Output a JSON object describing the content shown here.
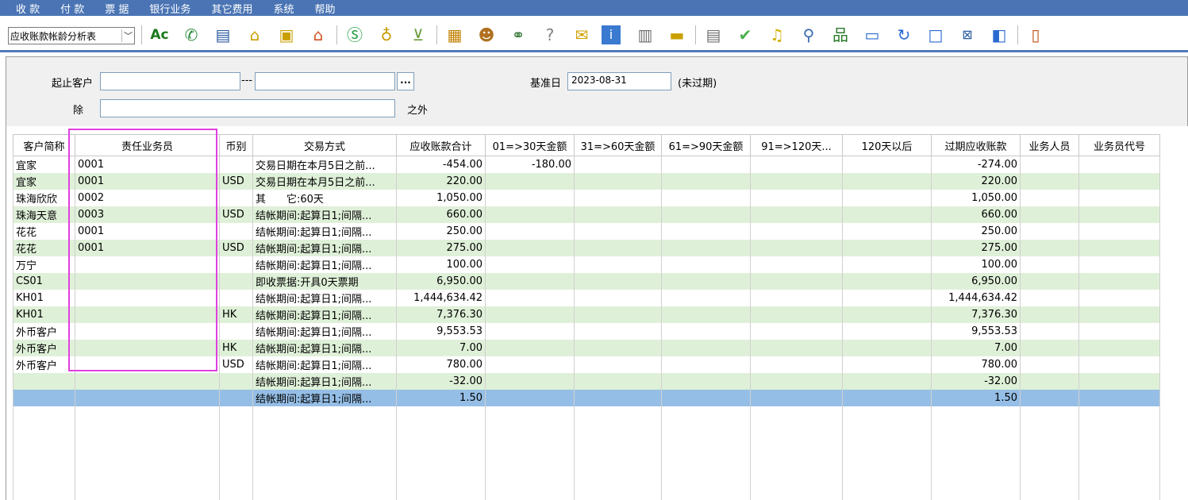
{
  "menu": [
    "收 款",
    "付 款",
    "票 据",
    "银行业务",
    "其它费用",
    "系统",
    "帮助"
  ],
  "toolbar": {
    "module_select": "应收账款帐龄分析表",
    "icons": [
      "spell-check-icon",
      "phone-icon",
      "computer-icon",
      "lock-icon",
      "briefcase-icon",
      "home-icon",
      "dollar-icon",
      "money-bag-icon",
      "cart-icon",
      "clipboard-icon",
      "users-icon",
      "link-icon",
      "help-icon",
      "mail-icon",
      "info-icon",
      "calculator-icon",
      "folder-icon",
      "document-icon",
      "check-icon",
      "bell-icon",
      "search-icon",
      "network-icon",
      "monitor-icon",
      "refresh-icon",
      "window-icon",
      "close-icon",
      "restore-icon",
      "exit-icon"
    ]
  },
  "filter": {
    "customer_range_label": "起止客户",
    "customer_from": "",
    "customer_to": "",
    "range_sep": "---",
    "browse": "...",
    "base_date_label": "基准日",
    "base_date": "2023-08-31",
    "base_date_status": "(未过期)",
    "exclude_label": "除",
    "exclude_value": "",
    "exclude_suffix": "之外"
  },
  "grid": {
    "columns": [
      "客户简称",
      "责任业务员",
      "币别",
      "交易方式",
      "应收账款合计",
      "01=>30天金额",
      "31=>60天金额",
      "61=>90天金额",
      "91=>120天...",
      "120天以后",
      "过期应收账款",
      "业务人员",
      "业务员代号"
    ],
    "rows": [
      [
        "宜家",
        "0001",
        "",
        "交易日期在本月5日之前...",
        "-454.00",
        "-180.00",
        "",
        "",
        "",
        "",
        "-274.00",
        "",
        ""
      ],
      [
        "宜家",
        "0001",
        "USD",
        "交易日期在本月5日之前...",
        "220.00",
        "",
        "",
        "",
        "",
        "",
        "220.00",
        "",
        ""
      ],
      [
        "珠海欣欣",
        "0002",
        "",
        "其　　它:60天",
        "1,050.00",
        "",
        "",
        "",
        "",
        "",
        "1,050.00",
        "",
        ""
      ],
      [
        "珠海天意",
        "0003",
        "USD",
        "结帐期间:起算日1;间隔...",
        "660.00",
        "",
        "",
        "",
        "",
        "",
        "660.00",
        "",
        ""
      ],
      [
        "花花",
        "0001",
        "",
        "结帐期间:起算日1;间隔...",
        "250.00",
        "",
        "",
        "",
        "",
        "",
        "250.00",
        "",
        ""
      ],
      [
        "花花",
        "0001",
        "USD",
        "结帐期间:起算日1;间隔...",
        "275.00",
        "",
        "",
        "",
        "",
        "",
        "275.00",
        "",
        ""
      ],
      [
        "万宁",
        "",
        "",
        "结帐期间:起算日1;间隔...",
        "100.00",
        "",
        "",
        "",
        "",
        "",
        "100.00",
        "",
        ""
      ],
      [
        "CS01",
        "",
        "",
        "即收票据:开具0天票期",
        "6,950.00",
        "",
        "",
        "",
        "",
        "",
        "6,950.00",
        "",
        ""
      ],
      [
        "KH01",
        "",
        "",
        "结帐期间:起算日1;间隔...",
        "1,444,634.42",
        "",
        "",
        "",
        "",
        "",
        "1,444,634.42",
        "",
        ""
      ],
      [
        "KH01",
        "",
        "HK",
        "结帐期间:起算日1;间隔...",
        "7,376.30",
        "",
        "",
        "",
        "",
        "",
        "7,376.30",
        "",
        ""
      ],
      [
        "外币客户",
        "",
        "",
        "结帐期间:起算日1;间隔...",
        "9,553.53",
        "",
        "",
        "",
        "",
        "",
        "9,553.53",
        "",
        ""
      ],
      [
        "外币客户",
        "",
        "HK",
        "结帐期间:起算日1;间隔...",
        "7.00",
        "",
        "",
        "",
        "",
        "",
        "7.00",
        "",
        ""
      ],
      [
        "外币客户",
        "",
        "USD",
        "结帐期间:起算日1;间隔...",
        "780.00",
        "",
        "",
        "",
        "",
        "",
        "780.00",
        "",
        ""
      ],
      [
        "",
        "",
        "",
        "结帐期间:起算日1;间隔...",
        "-32.00",
        "",
        "",
        "",
        "",
        "",
        "-32.00",
        "",
        ""
      ],
      [
        "",
        "",
        "",
        "结帐期间:起算日1;间隔...",
        "1.50",
        "",
        "",
        "",
        "",
        "",
        "1.50",
        "",
        ""
      ]
    ],
    "selected_row": 14
  },
  "colors": {
    "menubar": "#4a74b4",
    "row_alt": "#dff0d8",
    "row_selected": "#95bee6",
    "highlight": "#e040e0"
  }
}
